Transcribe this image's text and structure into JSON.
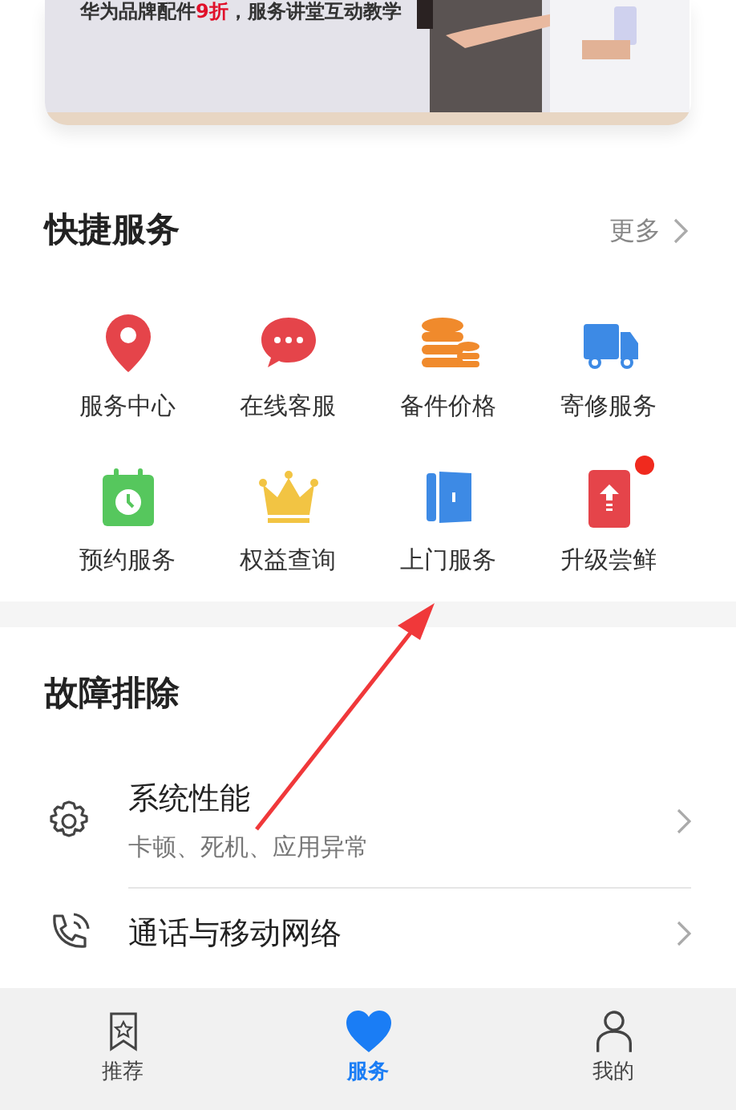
{
  "banner": {
    "kind": "picture",
    "caption": [
      {
        "text": "华为品牌配件",
        "highlight": false
      },
      {
        "text": "9折",
        "highlight": true
      },
      {
        "text": "，服务讲堂互动教学",
        "highlight": false
      }
    ]
  },
  "quick_services": {
    "title": "快捷服务",
    "more": "更多",
    "items": [
      {
        "label": "服务中心",
        "badge": false
      },
      {
        "label": "在线客服",
        "badge": false
      },
      {
        "label": "备件价格",
        "badge": false
      },
      {
        "label": "寄修服务",
        "badge": false
      },
      {
        "label": "预约服务",
        "badge": false
      },
      {
        "label": "权益查询",
        "badge": false
      },
      {
        "label": "上门服务",
        "badge": false
      },
      {
        "label": "升级尝鲜",
        "badge": true
      }
    ]
  },
  "troubleshooting": {
    "title": "故障排除",
    "items": [
      {
        "title": "系统性能",
        "subtitle": "卡顿、死机、应用异常"
      },
      {
        "title": "通话与移动网络"
      }
    ]
  },
  "tab_bar": [
    {
      "label": "推荐",
      "selected": false
    },
    {
      "label": "服务",
      "selected": true
    },
    {
      "label": "我的",
      "selected": false
    }
  ]
}
